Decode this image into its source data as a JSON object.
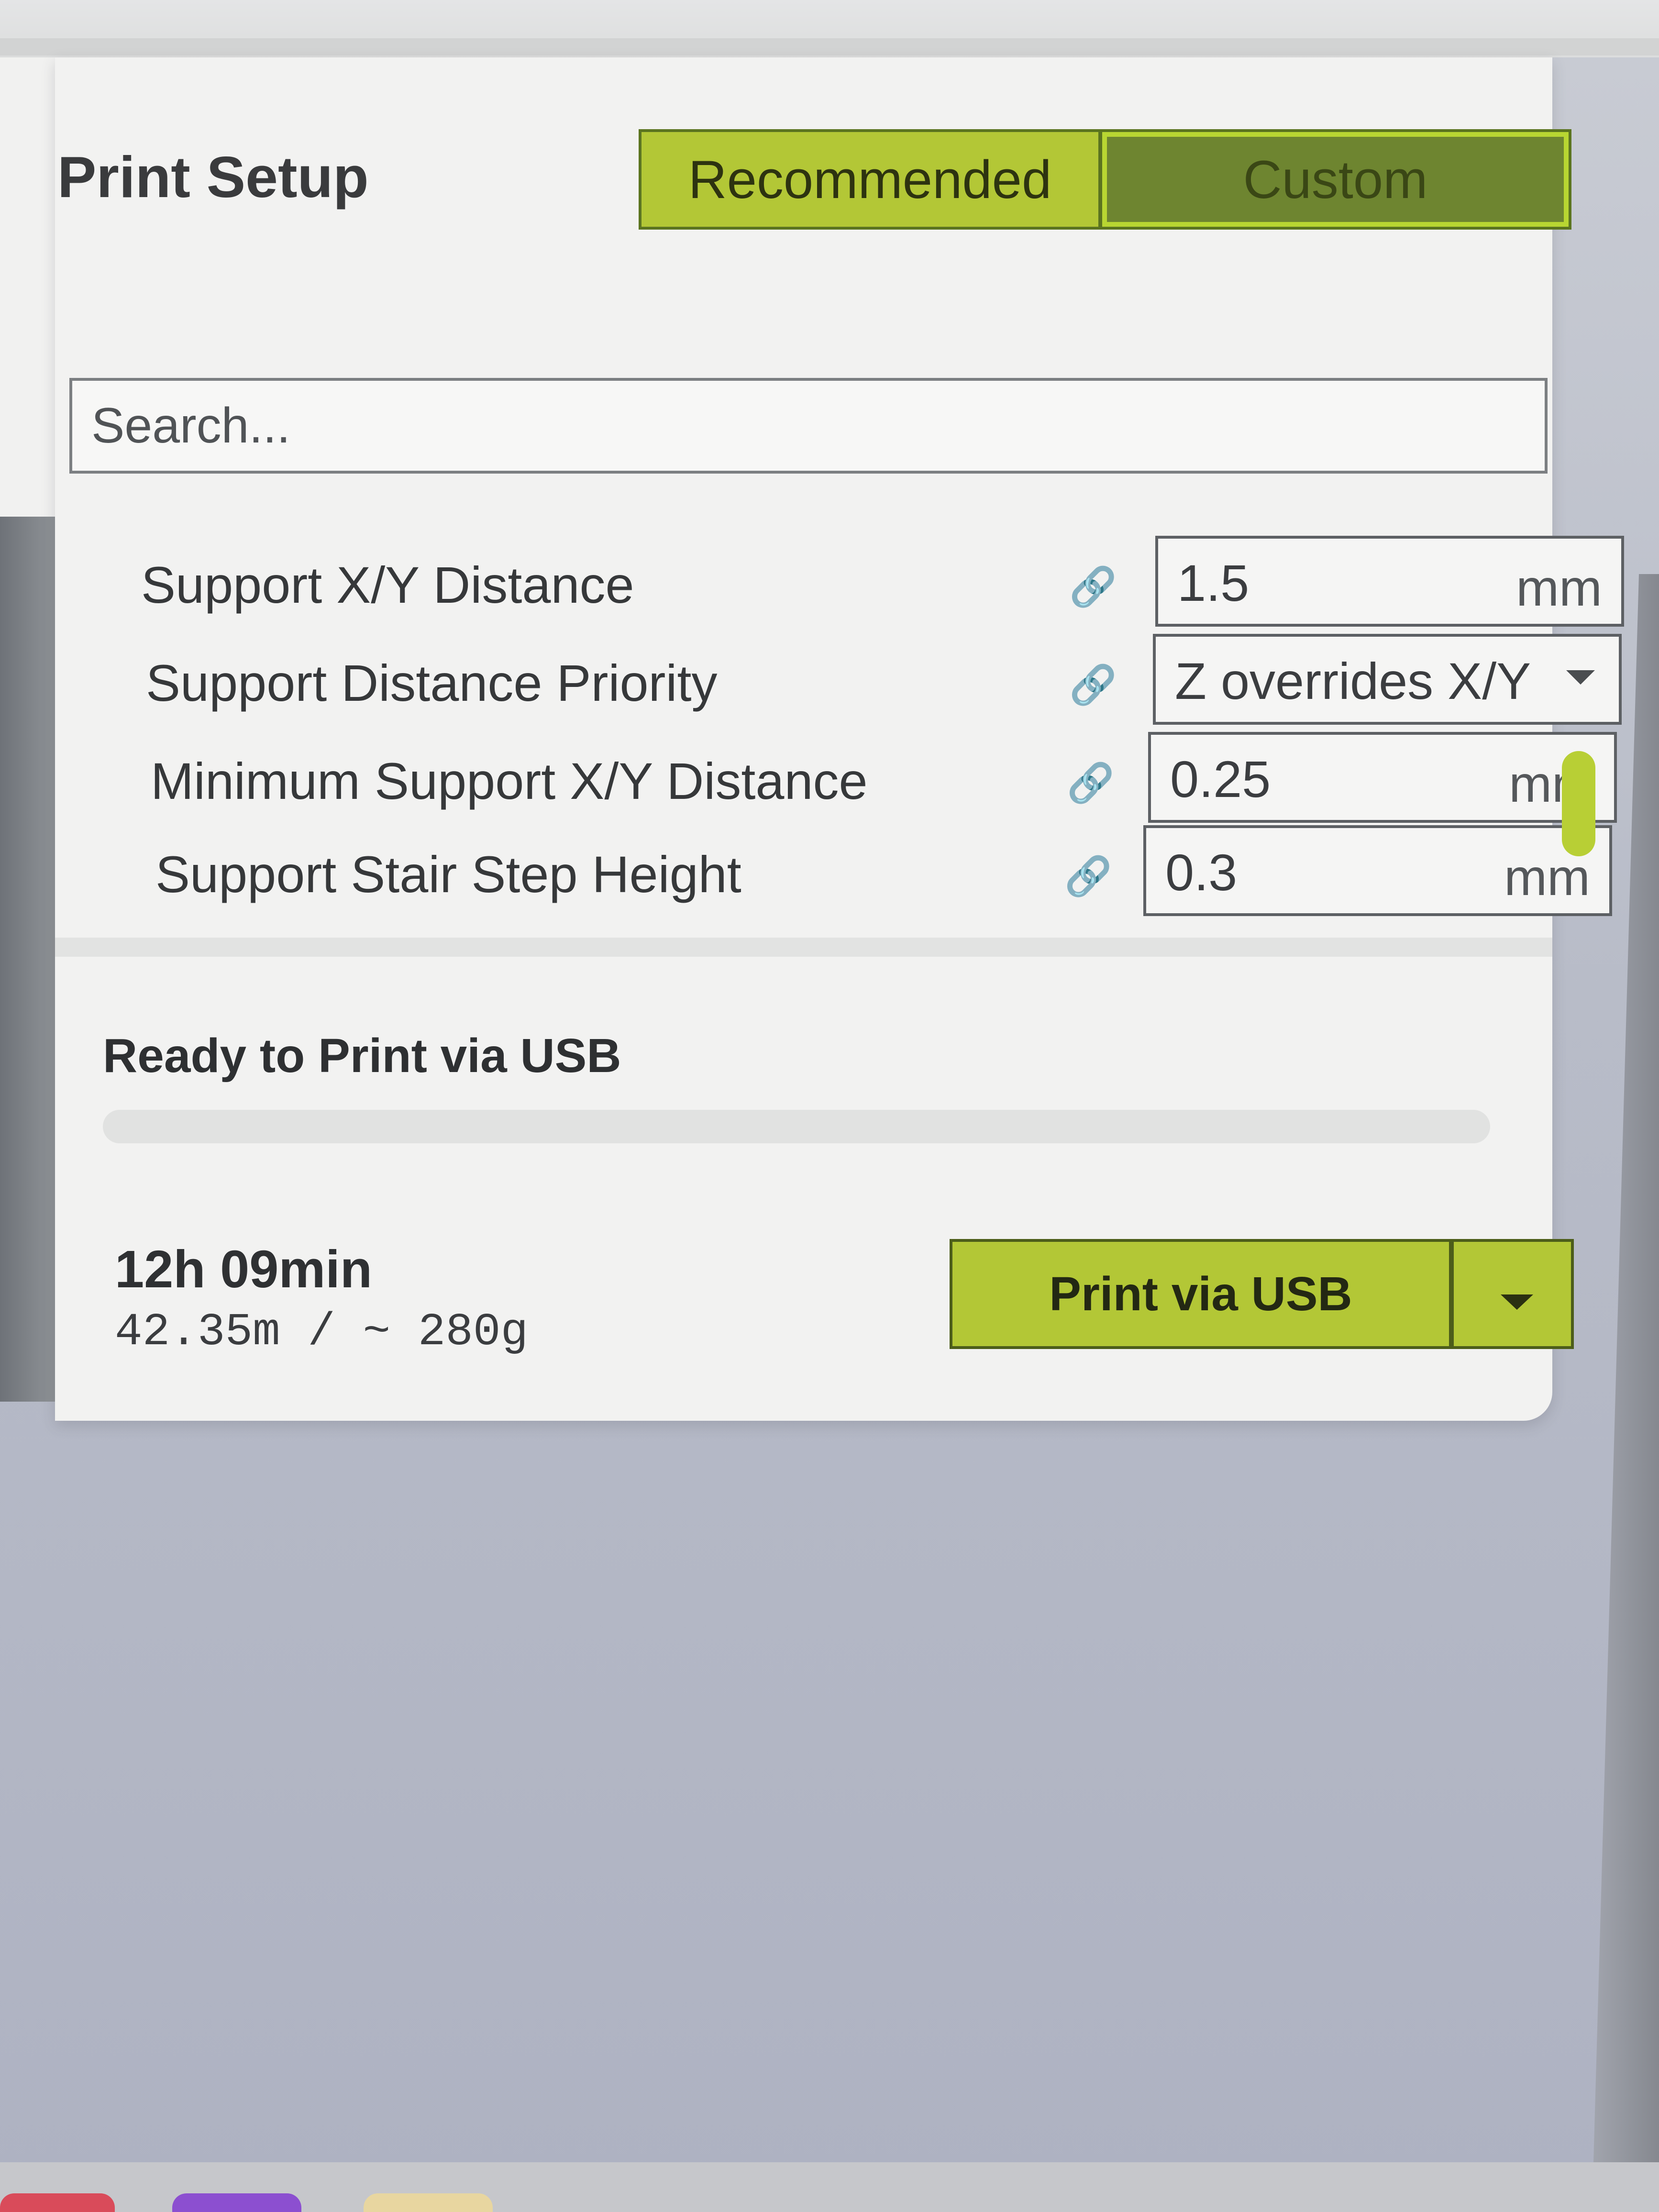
{
  "header": {
    "title": "Print Setup",
    "tabs": [
      {
        "label": "Recommended",
        "active": false
      },
      {
        "label": "Custom",
        "active": true
      }
    ]
  },
  "search": {
    "placeholder": "Search..."
  },
  "settings": [
    {
      "label": "Support X/Y Distance",
      "value": "1.5",
      "unit": "mm",
      "type": "number"
    },
    {
      "label": "Support Distance Priority",
      "value": "Z overrides X/Y",
      "unit": "",
      "type": "select"
    },
    {
      "label": "Minimum Support X/Y Distance",
      "value": "0.25",
      "unit": "mm",
      "type": "number"
    },
    {
      "label": "Support Stair Step Height",
      "value": "0.3",
      "unit": "mm",
      "type": "number"
    }
  ],
  "status": {
    "ready_text": "Ready to Print via USB",
    "print_time": "12h 09min",
    "material_usage": "42.35m / ~ 280g"
  },
  "actions": {
    "print_label": "Print via USB"
  },
  "colors": {
    "accent": "#b3c736",
    "accent_dark": "#6e8530",
    "panel_bg": "#f2f2f1"
  },
  "icons": {
    "link": "link-icon",
    "dropdown": "chevron-down-icon"
  }
}
